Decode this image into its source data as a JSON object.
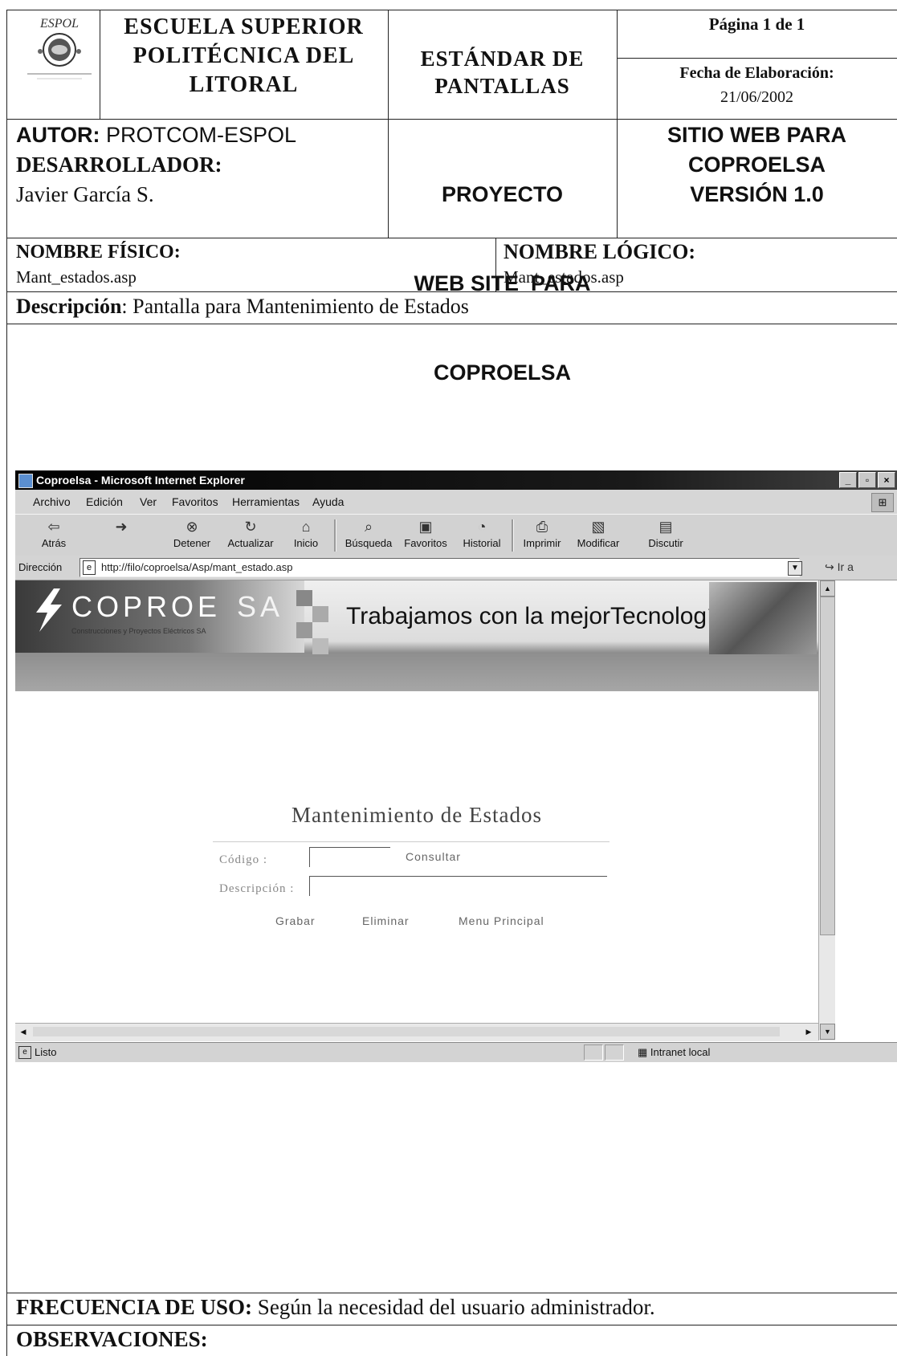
{
  "header": {
    "logo_text": "ESPOL",
    "institution": "ESCUELA SUPERIOR POLITÉCNICA DEL LITORAL",
    "inst_line1": "ESCUELA SUPERIOR",
    "inst_line2": "POLITÉCNICA DEL",
    "inst_line3": "LITORAL",
    "doc_type_line1": "ESTÁNDAR DE",
    "doc_type_line2": "PANTALLAS",
    "page": "Página 1 de 1",
    "date_label": "Fecha de Elaboración:",
    "date_value": "21/06/2002"
  },
  "project": {
    "author_label": "AUTOR:",
    "author_value": "PROTCOM-ESPOL",
    "developer_label": "DESARROLLADOR:",
    "developer_value": "Javier García S.",
    "project_line1": "PROYECTO",
    "project_line2": "WEB SITE  PARA",
    "project_line3": "COPROELSA",
    "site_line1": "SITIO WEB PARA",
    "site_line2": "COPROELSA",
    "site_line3": "VERSIÓN 1.0"
  },
  "names": {
    "physical_label": "NOMBRE FÍSICO:",
    "physical_value": "Mant_estados.asp",
    "logical_label": "NOMBRE LÓGICO:",
    "logical_value": "Mant_estados.asp"
  },
  "description": {
    "label": "Descripción",
    "value": ": Pantalla para Mantenimiento de Estados"
  },
  "browser": {
    "title": "Coproelsa - Microsoft Internet Explorer",
    "window_buttons": [
      "_",
      "▫",
      "×"
    ],
    "menu": [
      "Archivo",
      "Edición",
      "Ver",
      "Favoritos",
      "Herramientas",
      "Ayuda"
    ],
    "toolbar": [
      {
        "label": "Atrás",
        "icon": "back-arrow-icon",
        "glyph": "⇦"
      },
      {
        "label": "",
        "icon": "forward-arrow-icon",
        "glyph": "➜"
      },
      {
        "label": "Detener",
        "icon": "stop-icon",
        "glyph": "⊗"
      },
      {
        "label": "Actualizar",
        "icon": "refresh-icon",
        "glyph": "↻"
      },
      {
        "label": "Inicio",
        "icon": "home-icon",
        "glyph": "⌂"
      },
      {
        "label": "Búsqueda",
        "icon": "search-icon",
        "glyph": "⌕"
      },
      {
        "label": "Favoritos",
        "icon": "favorites-icon",
        "glyph": "▣"
      },
      {
        "label": "Historial",
        "icon": "history-icon",
        "glyph": "◔"
      },
      {
        "label": "Imprimir",
        "icon": "print-icon",
        "glyph": "⎙"
      },
      {
        "label": "Modificar",
        "icon": "edit-icon",
        "glyph": "▧"
      },
      {
        "label": "Discutir",
        "icon": "discuss-icon",
        "glyph": "▤"
      }
    ],
    "address_label": "Dirección",
    "url": "http://filo/coproelsa/Asp/mant_estado.asp",
    "go_label": "Ir a",
    "status": "Listo",
    "zone": "Intranet local"
  },
  "site": {
    "brand_left": "COPROE",
    "brand_right": "SA",
    "brand_sub": "Construcciones y Proyectos Eléctricos SA",
    "slogan": "Trabajamos con la mejorTecnología"
  },
  "form": {
    "title": "Mantenimiento de Estados",
    "code_label": "Código :",
    "code_value": "",
    "description_label": "Descripción :",
    "description_value": "",
    "consult": "Consultar",
    "save": "Grabar",
    "delete": "Eliminar",
    "main_menu": "Menu Principal"
  },
  "footer": {
    "frequency_label": "FRECUENCIA DE USO:",
    "frequency_value": "Según la necesidad del usuario administrador.",
    "observations_label": "OBSERVACIONES:"
  }
}
